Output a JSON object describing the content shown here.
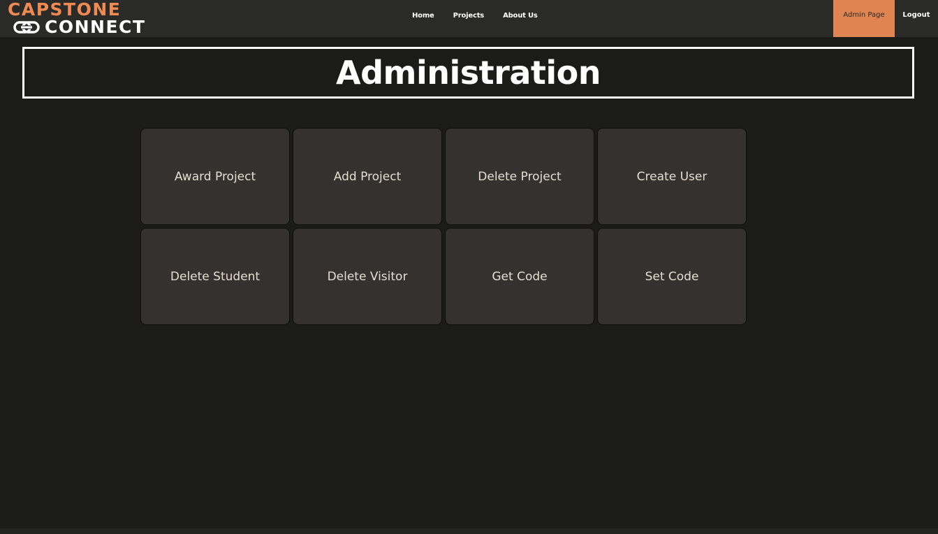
{
  "brand": {
    "line1": "CAPSTONE",
    "line2": "CONNECT",
    "icon": "link-icon",
    "accent_color": "#ee8a52"
  },
  "nav": {
    "links": [
      {
        "label": "Home"
      },
      {
        "label": "Projects"
      },
      {
        "label": "About Us"
      }
    ],
    "admin_label": "Admin Page",
    "admin_color": "#e08451",
    "logout_label": "Logout"
  },
  "page": {
    "title": "Administration"
  },
  "actions": [
    {
      "label": "Award Project"
    },
    {
      "label": "Add Project"
    },
    {
      "label": "Delete Project"
    },
    {
      "label": "Create User"
    },
    {
      "label": "Delete Student"
    },
    {
      "label": "Delete Visitor"
    },
    {
      "label": "Get Code"
    },
    {
      "label": "Set Code"
    }
  ]
}
